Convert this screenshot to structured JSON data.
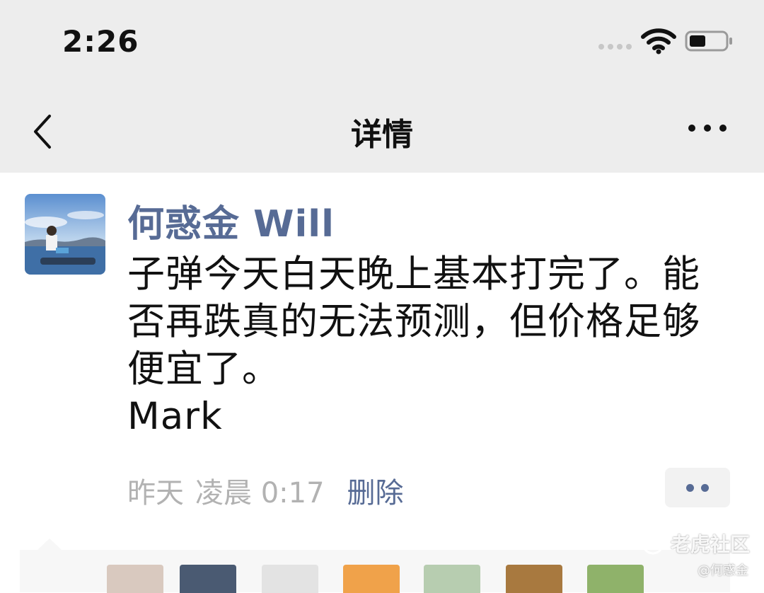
{
  "status_bar": {
    "time": "2:26"
  },
  "nav": {
    "title": "详情"
  },
  "post": {
    "author": "何惑金 Will",
    "lines": [
      "子弹今天白天晚上基本打完了。能",
      "否再跌真的无法预测，但价格足够",
      "便宜了。",
      "Mark"
    ],
    "meta": {
      "date": "昨天",
      "time": "凌晨 0:17",
      "delete_label": "删除"
    }
  },
  "colors": {
    "link": "#576b95",
    "bar_bg": "#ededed",
    "meta_gray": "#b2b2b2"
  },
  "watermark": {
    "brand": "老虎社区",
    "handle": "@何惑金"
  }
}
